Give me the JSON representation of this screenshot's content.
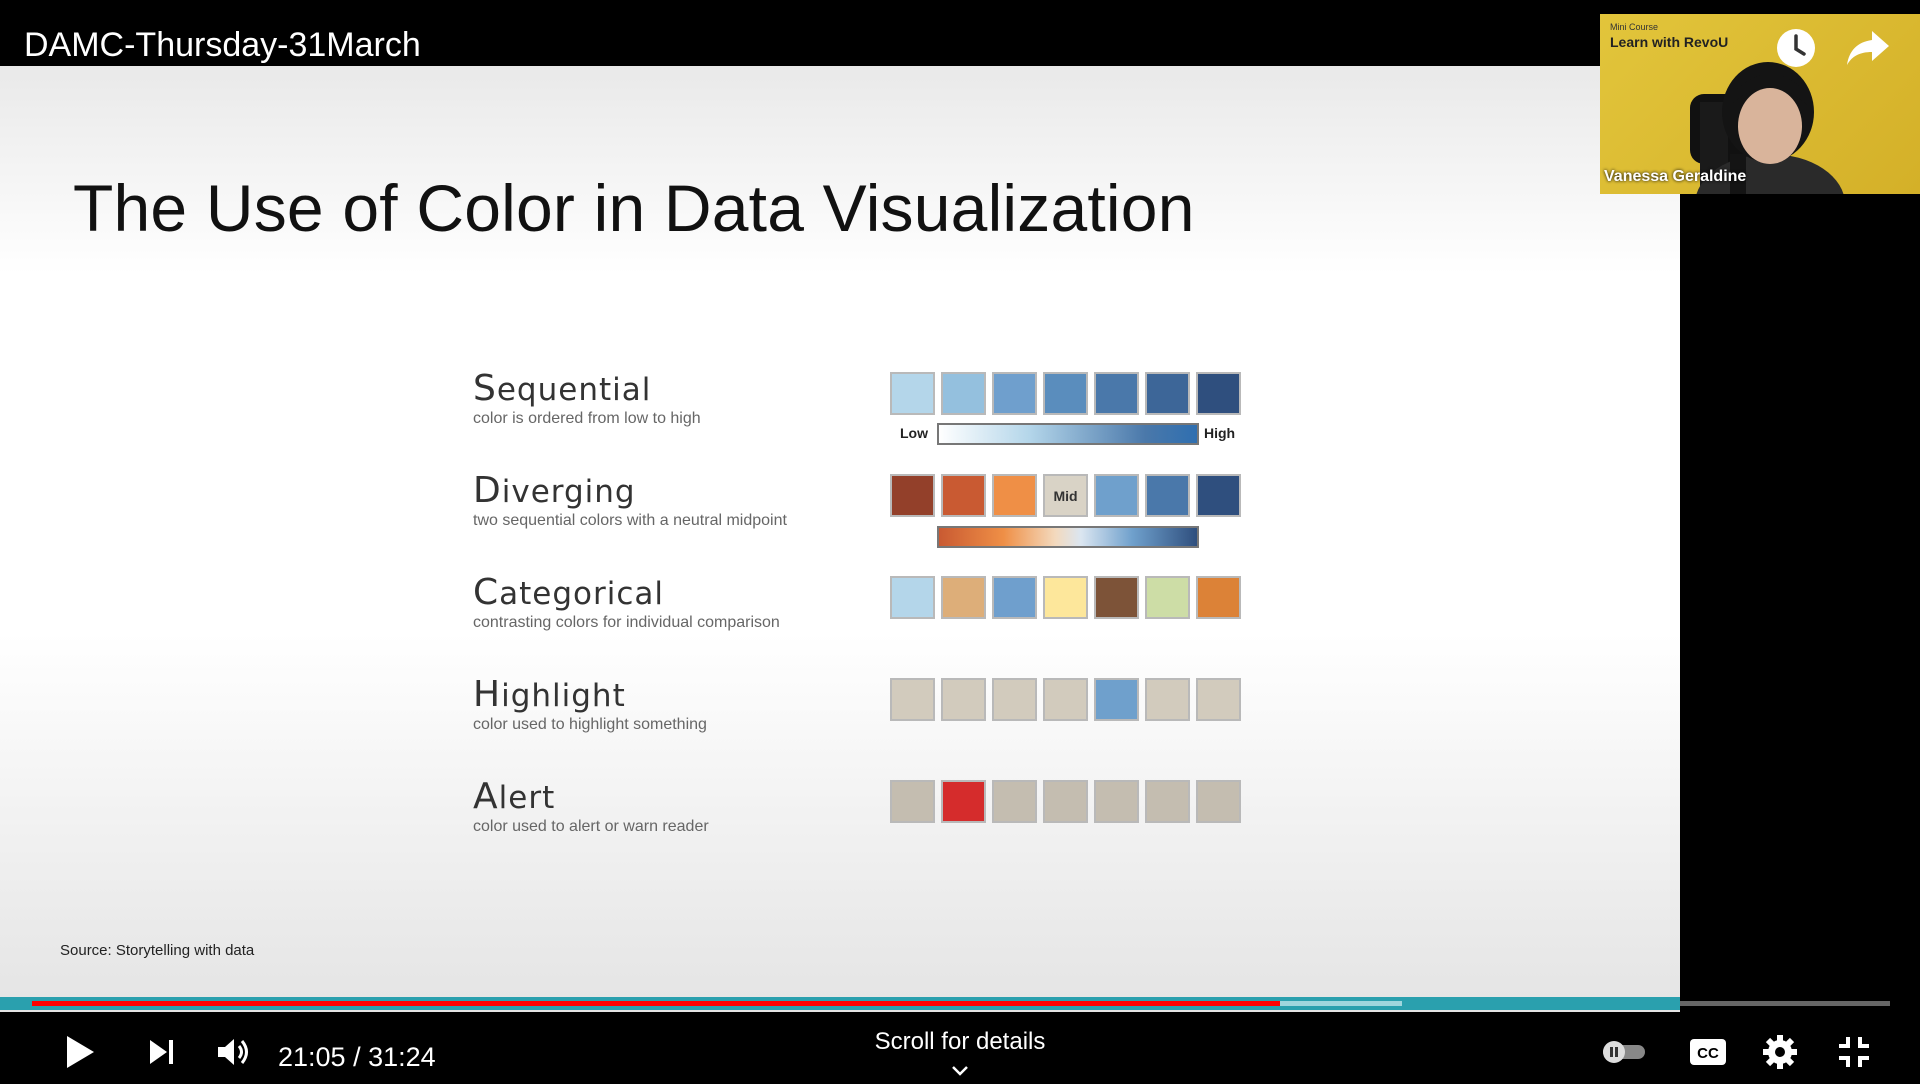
{
  "video": {
    "title": "DAMC-Thursday-31March"
  },
  "slide": {
    "title": "The Use of Color in Data Visualization",
    "source": "Source: Storytelling with data",
    "rows": [
      {
        "name": "Sequential",
        "desc": "color is ordered from low to high",
        "swatches": [
          "#b4d6ea",
          "#94c0de",
          "#6f9fcd",
          "#5a8dbd",
          "#4a78aa",
          "#3d6698",
          "#2f4f7e"
        ],
        "low_label": "Low",
        "high_label": "High"
      },
      {
        "name": "Diverging",
        "desc": "two sequential colors with a neutral midpoint",
        "swatches": [
          "#93402a",
          "#c95a32",
          "#ef8f46",
          "#d9d3c6",
          "#6fa0cc",
          "#4a78aa",
          "#2f4f7e"
        ],
        "mid_label": "Mid"
      },
      {
        "name": "Categorical",
        "desc": "contrasting colors for individual comparison",
        "swatches": [
          "#b4d6ea",
          "#ddae79",
          "#6f9fcd",
          "#fde79b",
          "#7d5338",
          "#cddda6",
          "#dc8237"
        ]
      },
      {
        "name": "Highlight",
        "desc": "color used to highlight something",
        "swatches": [
          "#d2cbbd",
          "#d2cbbd",
          "#d2cbbd",
          "#d2cbbd",
          "#6fa0cc",
          "#d2cbbd",
          "#d2cbbd"
        ]
      },
      {
        "name": "Alert",
        "desc": "color used to alert or warn reader",
        "swatches": [
          "#c4bdb0",
          "#d52c2c",
          "#c4bdb0",
          "#c4bdb0",
          "#c4bdb0",
          "#c4bdb0",
          "#c4bdb0"
        ]
      }
    ]
  },
  "webcam": {
    "small_text": "Mini Course",
    "course": "Learn with RevoU",
    "presenter": "Vanessa Geraldine"
  },
  "player": {
    "time": "21:05 / 31:24",
    "scroll_hint": "Scroll for details",
    "progress_played": 0.65,
    "progress_loaded": 0.71
  },
  "icons": {
    "play": "play-icon",
    "next": "next-icon",
    "volume": "volume-icon",
    "autoplay": "autoplay-toggle",
    "captions": "cc-icon",
    "settings": "gear-icon",
    "exit_fullscreen": "exit-fullscreen-icon",
    "watch_later": "clock-icon",
    "share": "share-icon",
    "chevron": "chevron-down-icon"
  }
}
